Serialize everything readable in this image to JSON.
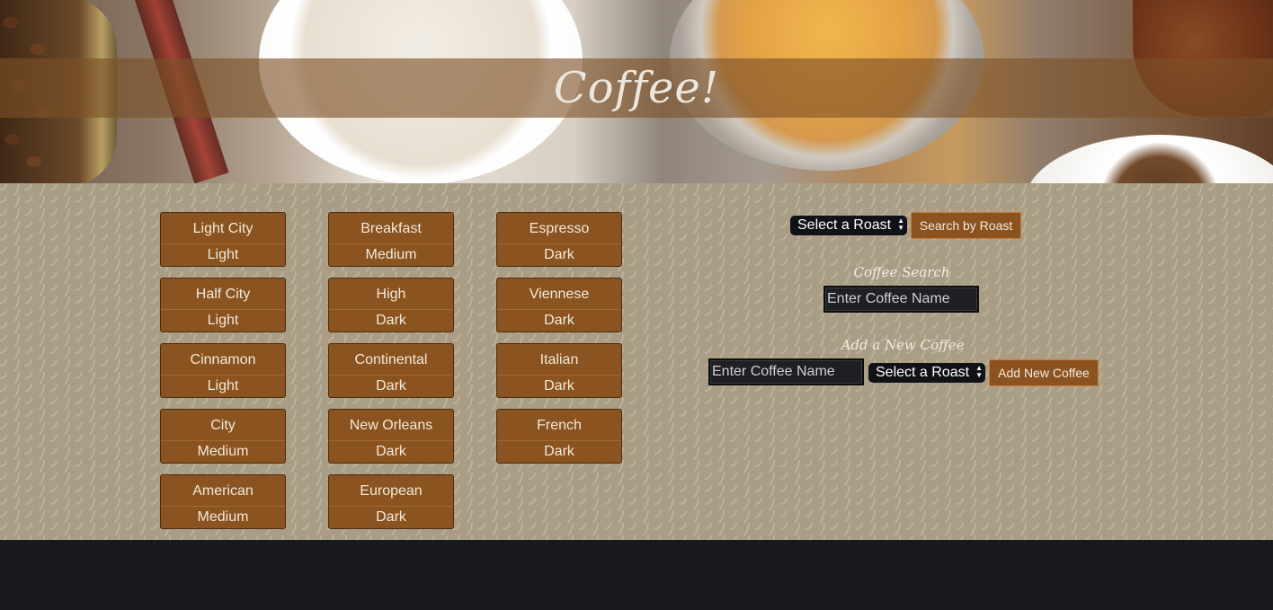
{
  "header": {
    "title": "Coffee!"
  },
  "coffees": [
    {
      "name": "Light City",
      "roast": "Light"
    },
    {
      "name": "Breakfast",
      "roast": "Medium"
    },
    {
      "name": "Espresso",
      "roast": "Dark"
    },
    {
      "name": "Half City",
      "roast": "Light"
    },
    {
      "name": "High",
      "roast": "Dark"
    },
    {
      "name": "Viennese",
      "roast": "Dark"
    },
    {
      "name": "Cinnamon",
      "roast": "Light"
    },
    {
      "name": "Continental",
      "roast": "Dark"
    },
    {
      "name": "Italian",
      "roast": "Dark"
    },
    {
      "name": "City",
      "roast": "Medium"
    },
    {
      "name": "New Orleans",
      "roast": "Dark"
    },
    {
      "name": "French",
      "roast": "Dark"
    },
    {
      "name": "American",
      "roast": "Medium"
    },
    {
      "name": "European",
      "roast": "Dark"
    }
  ],
  "roast_filter": {
    "select_value": "Select a Roast",
    "button_label": "Search by Roast"
  },
  "search": {
    "heading": "Coffee Search",
    "placeholder": "Enter Coffee Name"
  },
  "add_coffee": {
    "heading": "Add a New Coffee",
    "name_placeholder": "Enter Coffee Name",
    "select_value": "Select a Roast",
    "button_label": "Add New Coffee"
  },
  "colors": {
    "card_brown": "#8a531f",
    "background_tan": "#aa9d86",
    "footer_dark": "#18191c"
  }
}
